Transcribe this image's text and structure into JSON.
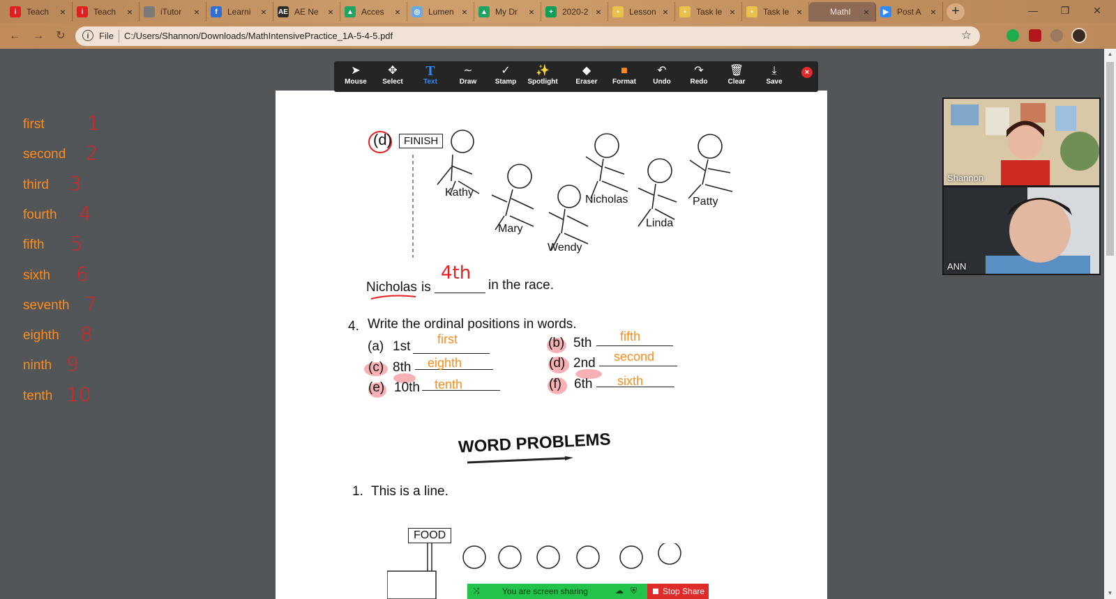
{
  "browser": {
    "tabs": [
      {
        "title": "Teach",
        "favicon": "i-tutor-red",
        "color": "#e02020",
        "glyph": "i"
      },
      {
        "title": "Teach",
        "favicon": "i-tutor-red",
        "color": "#e02020",
        "glyph": "i"
      },
      {
        "title": "iTutor",
        "favicon": "globe-gray",
        "color": "#7a7a7a",
        "glyph": ""
      },
      {
        "title": "Learni",
        "favicon": "f-blue",
        "color": "#2f6fd6",
        "glyph": "f"
      },
      {
        "title": "AE Ne",
        "favicon": "ae-dark",
        "color": "#2b2b2b",
        "glyph": "AE"
      },
      {
        "title": "Acces",
        "favicon": "drive",
        "color": "#1fa463",
        "glyph": "▲"
      },
      {
        "title": "Lumen",
        "favicon": "lumen-blue",
        "color": "#6aa9e6",
        "glyph": "◎"
      },
      {
        "title": "My Dr",
        "favicon": "drive",
        "color": "#1fa463",
        "glyph": "▲"
      },
      {
        "title": "2020-2",
        "favicon": "sheets-green",
        "color": "#0f9d58",
        "glyph": "+"
      },
      {
        "title": "Lesson",
        "favicon": "doc-yellow",
        "color": "#e8c24a",
        "glyph": "▪"
      },
      {
        "title": "Task le",
        "favicon": "doc-yellow",
        "color": "#e8c24a",
        "glyph": "▪"
      },
      {
        "title": "Task le",
        "favicon": "doc-yellow",
        "color": "#e8c24a",
        "glyph": "▪"
      },
      {
        "title": "MathI",
        "favicon": "pdf",
        "color": "#8c6a55",
        "glyph": "",
        "active": true
      },
      {
        "title": "Post A",
        "favicon": "zoom-blue",
        "color": "#2d8cff",
        "glyph": "▶"
      }
    ],
    "new_tab_label": "+",
    "url_scheme": "File",
    "url": "C:/Users/Shannon/Downloads/MathIntensivePractice_1A-5-4-5.pdf"
  },
  "annotate_toolbar": {
    "tools": [
      {
        "label": "Mouse",
        "icon": "cursor-icon",
        "glyph": "➤"
      },
      {
        "label": "Select",
        "icon": "move-icon",
        "glyph": "✥"
      },
      {
        "label": "Text",
        "icon": "text-icon",
        "glyph": "T",
        "active": true
      },
      {
        "label": "Draw",
        "icon": "draw-icon",
        "glyph": "∼"
      },
      {
        "label": "Stamp",
        "icon": "checkmark-icon",
        "glyph": "✓"
      },
      {
        "label": "Spotlight",
        "icon": "spotlight-icon",
        "glyph": "✨"
      },
      {
        "label": "Eraser",
        "icon": "eraser-icon",
        "glyph": "◆"
      },
      {
        "label": "Format",
        "icon": "format-swatch-icon",
        "glyph": "■"
      },
      {
        "label": "Undo",
        "icon": "undo-icon",
        "glyph": "↶"
      },
      {
        "label": "Redo",
        "icon": "redo-icon",
        "glyph": "↷"
      },
      {
        "label": "Clear",
        "icon": "trash-icon",
        "glyph": "🗑"
      },
      {
        "label": "Save",
        "icon": "save-icon",
        "glyph": "⤓"
      }
    ],
    "format_color": "#ff8c1a",
    "close_glyph": "×"
  },
  "ordinal_reference": [
    {
      "word": "first",
      "digit": "1"
    },
    {
      "word": "second",
      "digit": "2"
    },
    {
      "word": "third",
      "digit": "3"
    },
    {
      "word": "fourth",
      "digit": "4"
    },
    {
      "word": "fifth",
      "digit": "5"
    },
    {
      "word": "sixth",
      "digit": "6"
    },
    {
      "word": "seventh",
      "digit": "7"
    },
    {
      "word": "eighth",
      "digit": "8"
    },
    {
      "word": "ninth",
      "digit": "9"
    },
    {
      "word": "tenth",
      "digit": "10"
    }
  ],
  "pdf": {
    "part_d": {
      "label": "(d)",
      "finish_sign": "FINISH",
      "runners": [
        "Kathy",
        "Mary",
        "Wendy",
        "Nicholas",
        "Linda",
        "Patty"
      ],
      "sentence_subject": "Nicholas",
      "sentence_mid": "is",
      "sentence_end": "in the race.",
      "answer": "4th"
    },
    "question4": {
      "number": "4.",
      "prompt": "Write the ordinal positions in words.",
      "items": [
        {
          "label": "(a)",
          "ordinal": "1st",
          "answer": "first"
        },
        {
          "label": "(b)",
          "ordinal": "5th",
          "answer": "fifth"
        },
        {
          "label": "(c)",
          "ordinal": "8th",
          "answer": "eighth"
        },
        {
          "label": "(d)",
          "ordinal": "2nd",
          "answer": "second"
        },
        {
          "label": "(e)",
          "ordinal": "10th",
          "answer": "tenth"
        },
        {
          "label": "(f)",
          "ordinal": "6th",
          "answer": "sixth"
        }
      ]
    },
    "word_problems_heading": "WORD PROBLEMS",
    "problem1": {
      "number": "1.",
      "text": "This is a line."
    },
    "food_sign": "FOOD"
  },
  "video_panel": [
    {
      "name": "Shannon"
    },
    {
      "name": "ANN"
    }
  ],
  "share_bar": {
    "status": "You are screen sharing",
    "stop_label": "Stop Share"
  },
  "colors": {
    "annotation_orange": "#ff8c1a",
    "annotation_red": "#e82020",
    "highlight_pink": "#f6a3a8",
    "share_green": "#23c24b",
    "stop_red": "#e02b2b"
  }
}
